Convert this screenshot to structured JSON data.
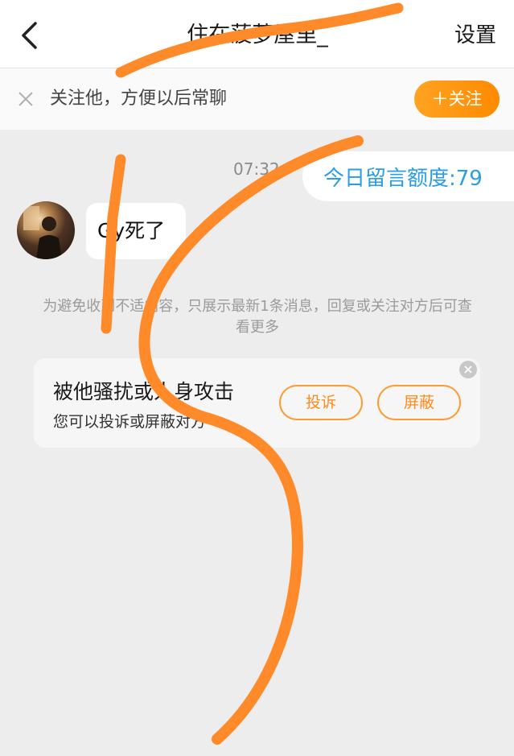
{
  "header": {
    "title": "住在菠萝屋里_",
    "settings_label": "设置",
    "back_icon": "chevron-left-icon"
  },
  "follow_banner": {
    "text": "关注他，方便以后常聊",
    "follow_button": "＋关注",
    "close_icon": "close-icon"
  },
  "chat": {
    "timestamp": "07:32",
    "quota_label": "今日留言额度:79",
    "message": "Gy死了",
    "notice": "为避免收到不适内容，只展示最新1条消息，回复或关注对方后可查看更多"
  },
  "report_card": {
    "title": "被他骚扰或人身攻击",
    "subtitle": "您可以投诉或屏蔽对方",
    "report_button": "投诉",
    "block_button": "屏蔽"
  },
  "colors": {
    "accent": "#ff8a00",
    "quota_text": "#2a9de8",
    "scribble": "#ff8a2a"
  }
}
